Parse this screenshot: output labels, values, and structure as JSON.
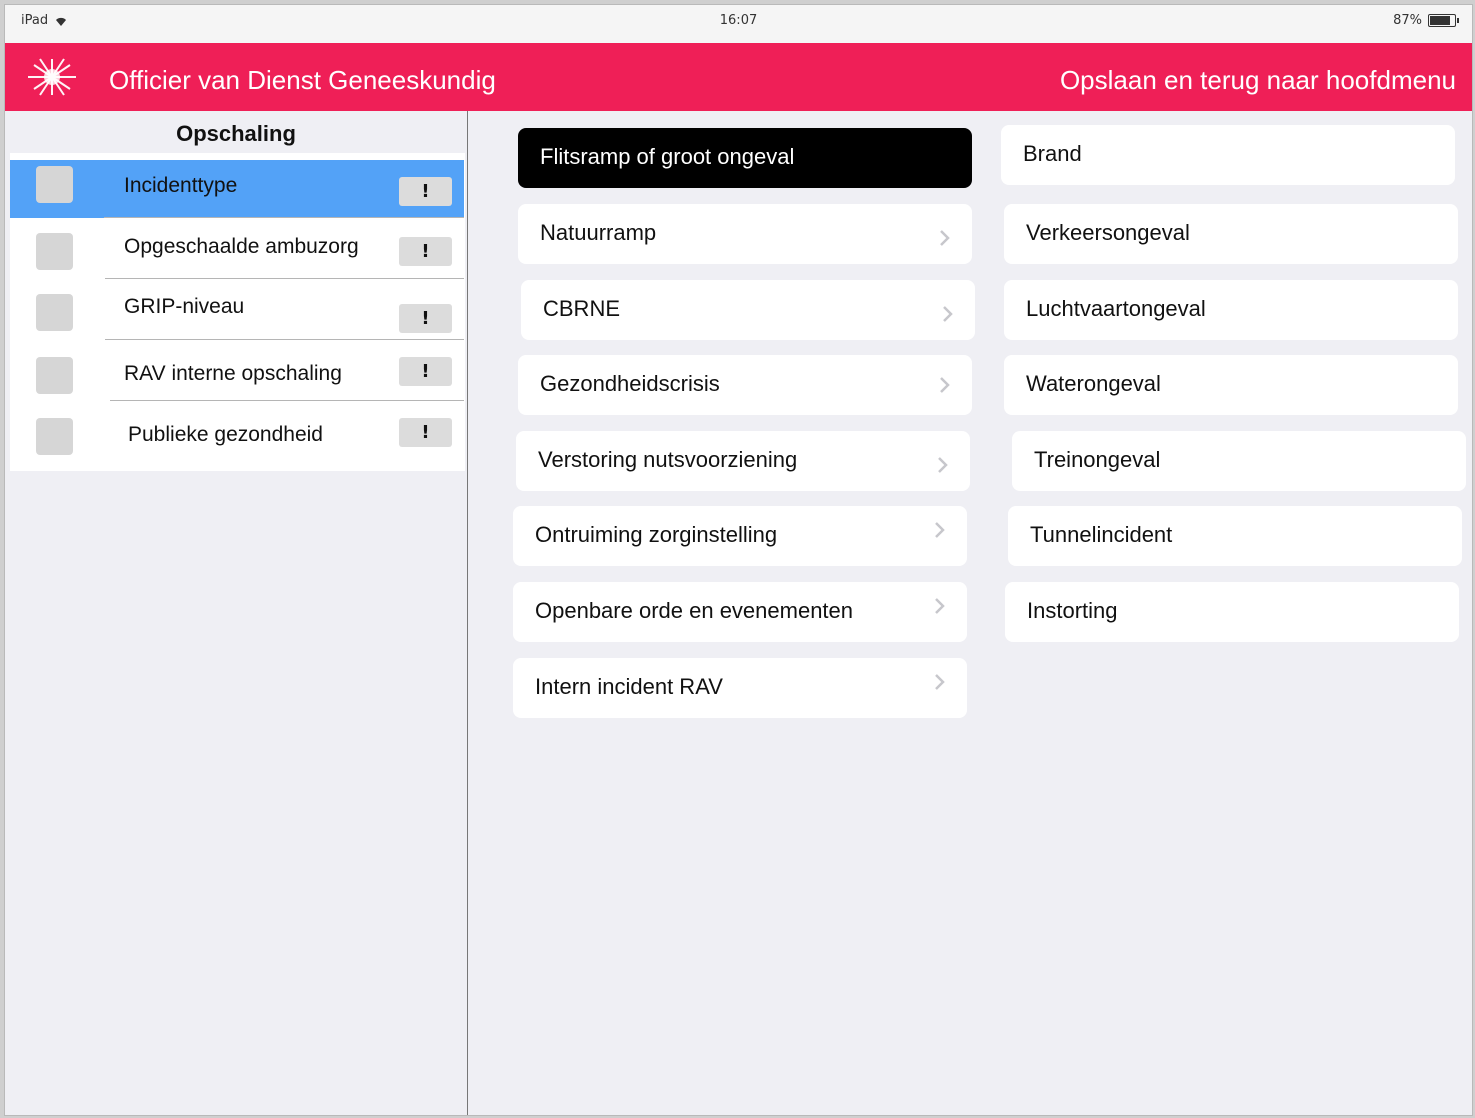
{
  "status_bar": {
    "device": "iPad",
    "wifi_icon": "wifi-icon",
    "time": "16:07",
    "battery": "87%"
  },
  "header": {
    "title": "Officier van Dienst Geneeskundig",
    "action_label": "Opslaan en terug naar hoofdmenu",
    "background_color": "#ef1f57"
  },
  "sidebar": {
    "heading": "Opschaling",
    "items": [
      {
        "label": "Incidenttype",
        "badge": "!",
        "active": true
      },
      {
        "label": "Opgeschaalde ambuzorg",
        "badge": "!"
      },
      {
        "label": "GRIP-niveau",
        "badge": "!"
      },
      {
        "label": "RAV interne opschaling",
        "badge": "!"
      },
      {
        "label": "Publieke gezondheid",
        "badge": "!"
      }
    ],
    "active_color": "#53a2f7"
  },
  "incident_types": {
    "left_column": [
      {
        "label": "Flitsramp of groot ongeval",
        "selected": true
      },
      {
        "label": "Natuurramp"
      },
      {
        "label": "CBRNE"
      },
      {
        "label": "Gezondheidscrisis"
      },
      {
        "label": "Verstoring nutsvoorziening"
      },
      {
        "label": "Ontruiming zorginstelling"
      },
      {
        "label": "Openbare orde en evenementen"
      },
      {
        "label": "Intern incident RAV"
      }
    ],
    "right_column": [
      {
        "label": "Brand"
      },
      {
        "label": "Verkeersongeval"
      },
      {
        "label": "Luchtvaartongeval"
      },
      {
        "label": "Waterongeval"
      },
      {
        "label": "Treinongeval"
      },
      {
        "label": "Tunnelincident"
      },
      {
        "label": "Instorting"
      }
    ]
  }
}
